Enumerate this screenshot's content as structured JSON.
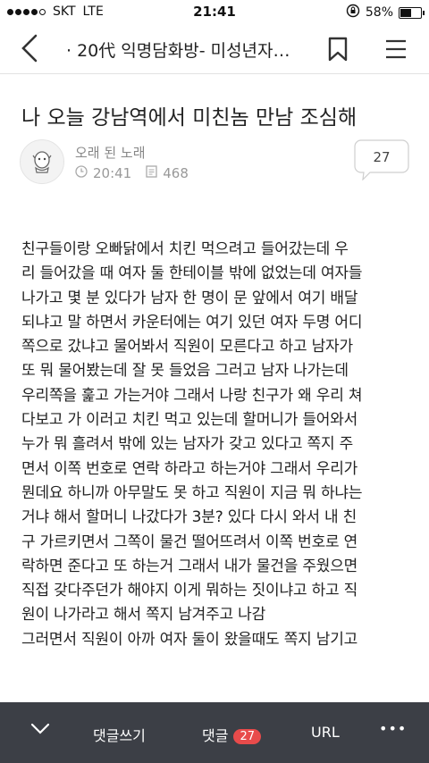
{
  "status_bar": {
    "carrier": "SKT",
    "network": "LTE",
    "time": "21:41",
    "battery": "58%",
    "battery_level": 0.58,
    "signal_bars": 4
  },
  "nav": {
    "title": "· 20代 익명담화방- 미성년자…"
  },
  "post": {
    "title": "나 오늘 강남역에서 미친놈 만남 조심해",
    "author": "오래 된 노래",
    "time": "20:41",
    "views": "468",
    "comment_count": "27",
    "body_lines": [
      "친구들이랑 오빠닭에서 치킨 먹으려고 들어갔는데 우",
      "리 들어갔을 때 여자 둘 한테이블 밖에 없었는데 여자들",
      "나가고 몇 분 있다가 남자 한 명이 문 앞에서 여기 배달",
      "되냐고 말 하면서 카운터에는 여기 있던 여자 두명 어디",
      "쪽으로 갔냐고 물어봐서 직원이 모른다고 하고 남자가",
      "또 뭐 물어봤는데 잘 못 들었음 그러고 남자 나가는데",
      "우리쪽을 훑고 가는거야 그래서 나랑 친구가 왜 우리 쳐",
      "다보고 가 이러고 치킨 먹고 있는데 할머니가 들어와서",
      "누가 뭐 흘려서 밖에 있는 남자가 갖고 있다고 쪽지 주",
      "면서 이쪽 번호로 연락 하라고 하는거야 그래서 우리가",
      "뭔데요 하니까 아무말도 못 하고 직원이 지금 뭐 하냐는",
      "거냐 해서 할머니 나갔다가 3분? 있다 다시 와서 내 친",
      "구 가르키면서 그쪽이 물건 떨어뜨려서 이쪽 번호로 연",
      "락하면 준다고 또 하는거 그래서 내가 물건을 주웠으면",
      "직접 갖다주던가 해야지 이게 뭐하는 짓이냐고 하고 직",
      "원이 나가라고 해서 쪽지 남겨주고 나감",
      "그러면서 직원이 아까 여자 둘이 왔을때도 쪽지 남기고"
    ]
  },
  "bottom_bar": {
    "write_comment": "댓글쓰기",
    "comments_label": "댓글",
    "comments_badge": "27",
    "url_label": "URL",
    "more_label": "•••"
  }
}
